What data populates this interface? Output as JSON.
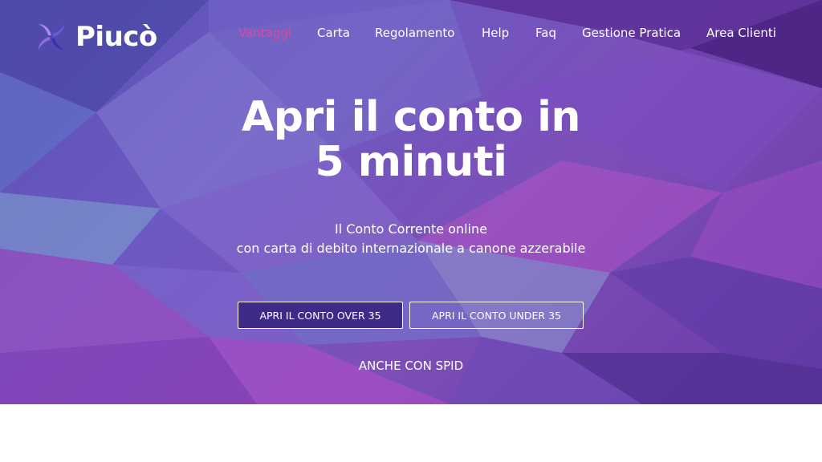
{
  "brand": {
    "name": "Piucò"
  },
  "nav": {
    "items": [
      {
        "label": "Vantaggi",
        "active": true
      },
      {
        "label": "Carta"
      },
      {
        "label": "Regolamento"
      },
      {
        "label": "Help"
      },
      {
        "label": "Faq"
      },
      {
        "label": "Gestione Pratica"
      },
      {
        "label": "Area Clienti"
      }
    ]
  },
  "hero": {
    "title_line1": "Apri il conto in",
    "title_line2": "5 minuti",
    "subtitle_line1": "Il Conto Corrente online",
    "subtitle_line2": "con carta di debito internazionale a canone azzerabile",
    "cta_over": "APRI IL CONTO OVER 35",
    "cta_under": "APRI IL CONTO UNDER 35",
    "spid_note": "ANCHE CON SPID"
  },
  "colors": {
    "nav_active": "#e0479e",
    "primary_button_bg": "#3d2b87",
    "hero_base": "#6c59c2"
  },
  "icons": {
    "logo": "pinwheel-logo-icon"
  }
}
